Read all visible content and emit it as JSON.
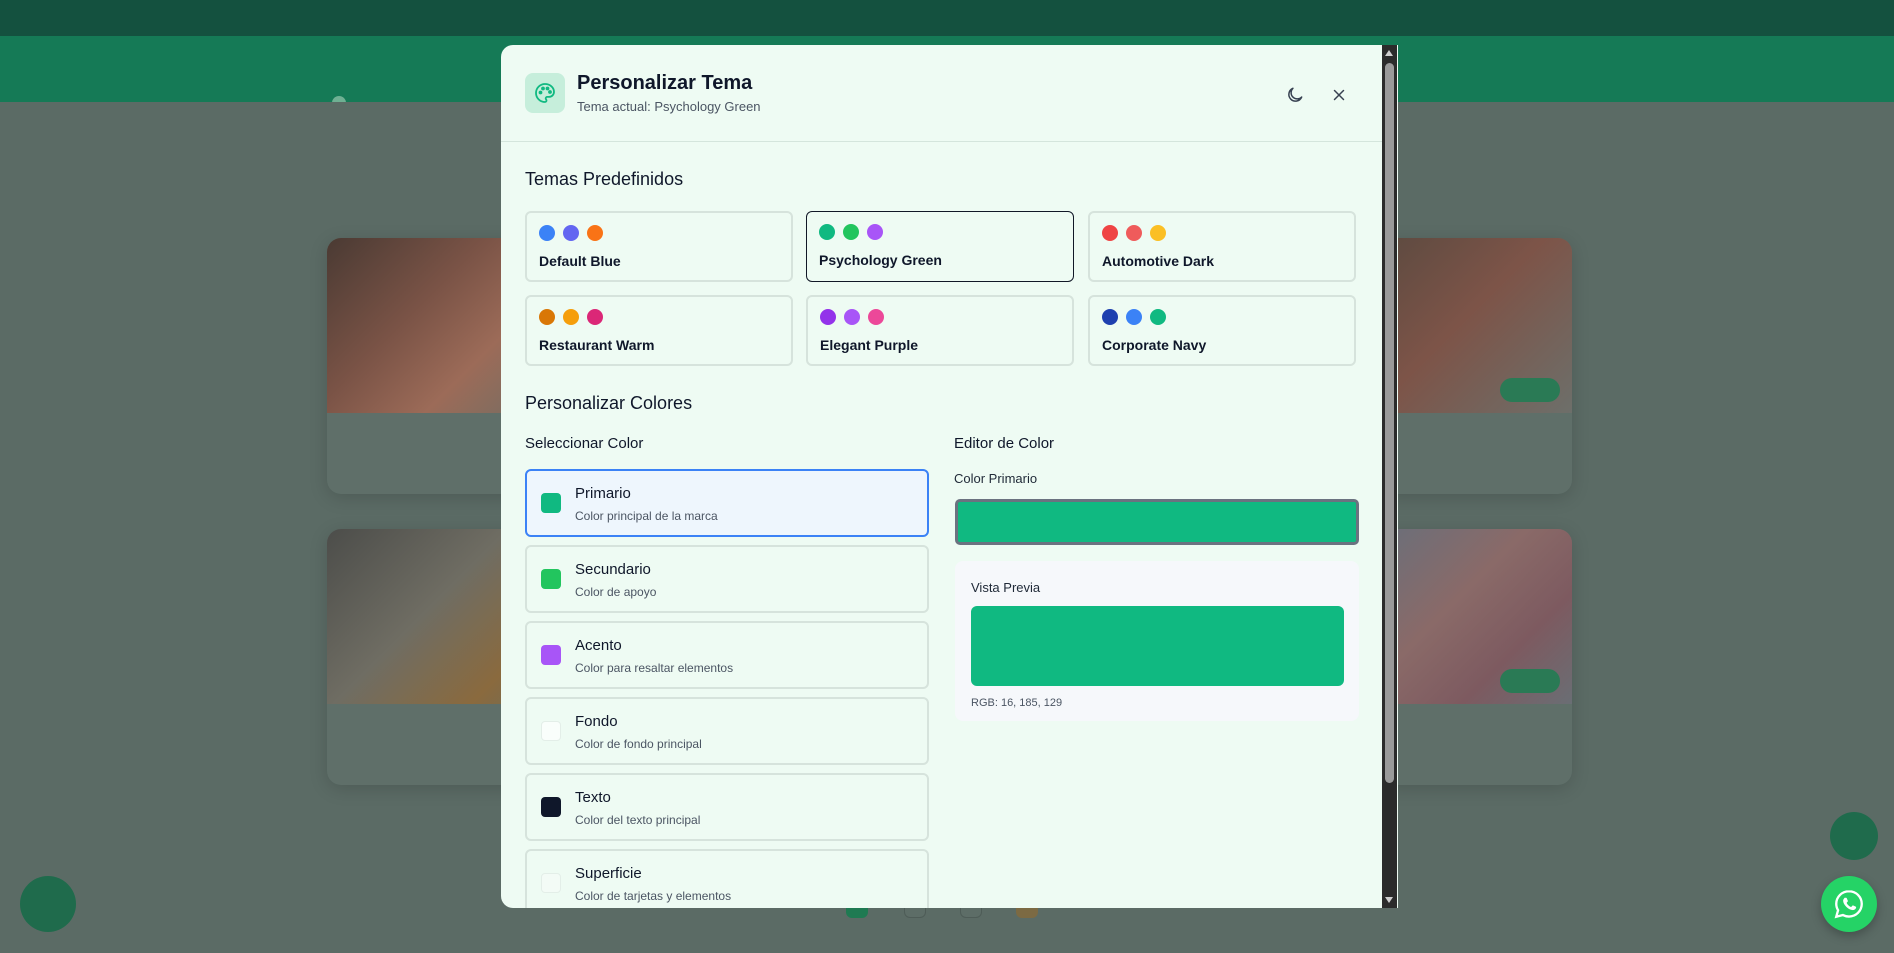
{
  "background": {
    "topbar": {
      "phone": "",
      "email": "",
      "promo": ""
    },
    "brand": "",
    "cards": [
      {
        "title": "",
        "desc": ""
      },
      {
        "title": "",
        "desc": ""
      },
      {
        "title": "",
        "desc": ""
      },
      {
        "title": "",
        "desc": ""
      }
    ]
  },
  "modal": {
    "title": "Personalizar Tema",
    "subtitle": "Tema actual: Psychology Green",
    "icons": {
      "header": "palette-icon",
      "dark_mode": "moon-icon",
      "close": "close-icon"
    }
  },
  "presets": {
    "title": "Temas Predefinidos",
    "selected": "Psychology Green",
    "items": [
      {
        "name": "Default Blue",
        "colors": [
          "#3b82f6",
          "#6366f1",
          "#f97316"
        ]
      },
      {
        "name": "Psychology Green",
        "colors": [
          "#10b981",
          "#22c55e",
          "#a855f7"
        ]
      },
      {
        "name": "Automotive Dark",
        "colors": [
          "#ef4444",
          "#ef5b5b",
          "#fbbf24"
        ]
      },
      {
        "name": "Restaurant Warm",
        "colors": [
          "#d97706",
          "#f59e0b",
          "#db2777"
        ]
      },
      {
        "name": "Elegant Purple",
        "colors": [
          "#9333ea",
          "#a855f7",
          "#ec4899"
        ]
      },
      {
        "name": "Corporate Navy",
        "colors": [
          "#1e40af",
          "#3b82f6",
          "#10b981"
        ]
      }
    ]
  },
  "customize": {
    "title": "Personalizar Colores",
    "select_title": "Seleccionar Color",
    "selected": "Primario",
    "colors": [
      {
        "label": "Primario",
        "desc": "Color principal de la marca",
        "value": "#10b981"
      },
      {
        "label": "Secundario",
        "desc": "Color de apoyo",
        "value": "#22c55e"
      },
      {
        "label": "Acento",
        "desc": "Color para resaltar elementos",
        "value": "#a855f7"
      },
      {
        "label": "Fondo",
        "desc": "Color de fondo principal",
        "value": "#f9fefb"
      },
      {
        "label": "Texto",
        "desc": "Color del texto principal",
        "value": "#0f172a"
      },
      {
        "label": "Superficie",
        "desc": "Color de tarjetas y elementos",
        "value": "#f3fbf6"
      }
    ]
  },
  "editor": {
    "title": "Editor de Color",
    "field_label": "Color Primario",
    "value": "#10b981",
    "preview_label": "Vista Previa",
    "rgb": "RGB: 16, 185, 129"
  },
  "whatsapp": {
    "icon": "whatsapp-icon"
  }
}
